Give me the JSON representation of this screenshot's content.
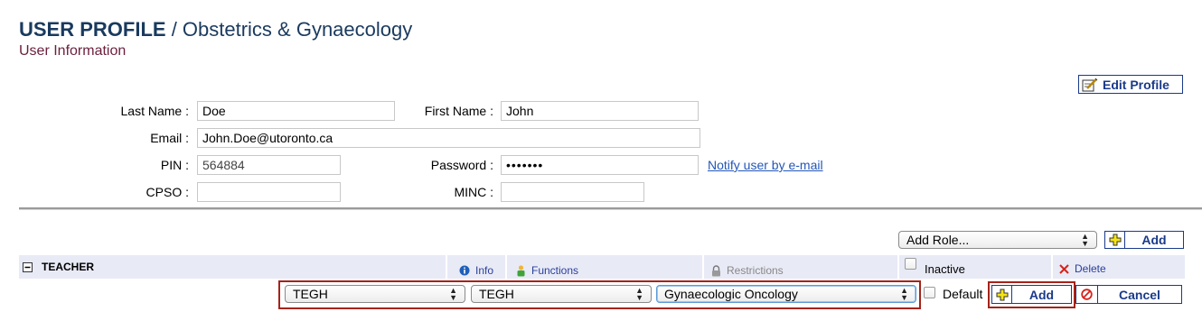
{
  "header": {
    "title_bold": "USER PROFILE",
    "title_rest": " / Obstetrics & Gynaecology",
    "subtitle": "User Information"
  },
  "toolbar": {
    "edit_profile_label": "Edit Profile"
  },
  "form": {
    "last_name_label": "Last Name :",
    "last_name_value": "Doe",
    "first_name_label": "First Name :",
    "first_name_value": "John",
    "email_label": "Email :",
    "email_value": "John.Doe@utoronto.ca",
    "pin_label": "PIN :",
    "pin_value": "564884",
    "password_label": "Password :",
    "password_value": "•••••••",
    "notify_link": "Notify user by e-mail",
    "cpso_label": "CPSO :",
    "cpso_value": "",
    "minc_label": "MINC :",
    "minc_value": ""
  },
  "roles": {
    "add_role_select": "Add Role...",
    "add_label": "Add",
    "role_title": "TEACHER",
    "info_label": "Info",
    "functions_label": "Functions",
    "restrictions_label": "Restrictions",
    "inactive_label": "Inactive",
    "delete_label": "Delete",
    "site_select_1": "TEGH",
    "site_select_2": "TEGH",
    "division_select": "Gynaecologic Oncology",
    "default_label": "Default",
    "row_add_label": "Add",
    "cancel_label": "Cancel"
  },
  "colors": {
    "title": "#1a3a5e",
    "subtitle": "#6b1e3c",
    "link": "#2356b8",
    "button_border": "#1a3a8a",
    "highlight": "#a5231b",
    "role_bar": "#e8eaf6"
  },
  "icons": [
    "edit-note-icon",
    "collapse-minus-icon",
    "info-icon",
    "user-functions-icon",
    "lock-restrictions-icon",
    "delete-x-icon",
    "add-plus-icon",
    "cancel-circle-icon"
  ]
}
